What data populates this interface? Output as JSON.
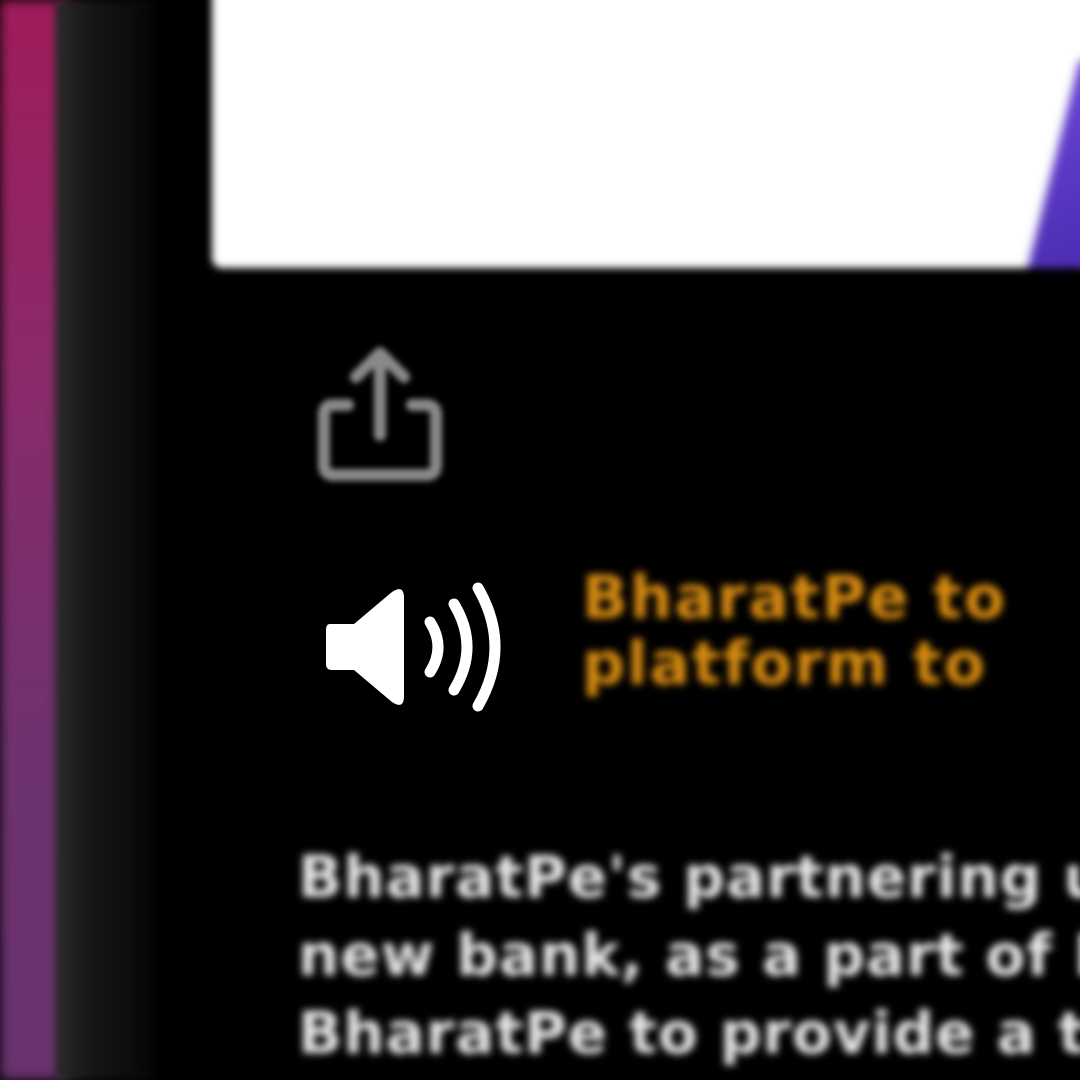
{
  "headline": {
    "lines": [
      "BharatPe to",
      "platform to"
    ]
  },
  "body": {
    "lines": [
      "BharatPe's partnering up w",
      "new bank, as a part of PM",
      "BharatPe to provide a tech"
    ]
  },
  "icons": {
    "share": "share-icon",
    "speaker": "speaker-volume-icon"
  },
  "colors": {
    "headline": "#d98c12",
    "background": "#000000",
    "accent": "#5a36c4"
  }
}
